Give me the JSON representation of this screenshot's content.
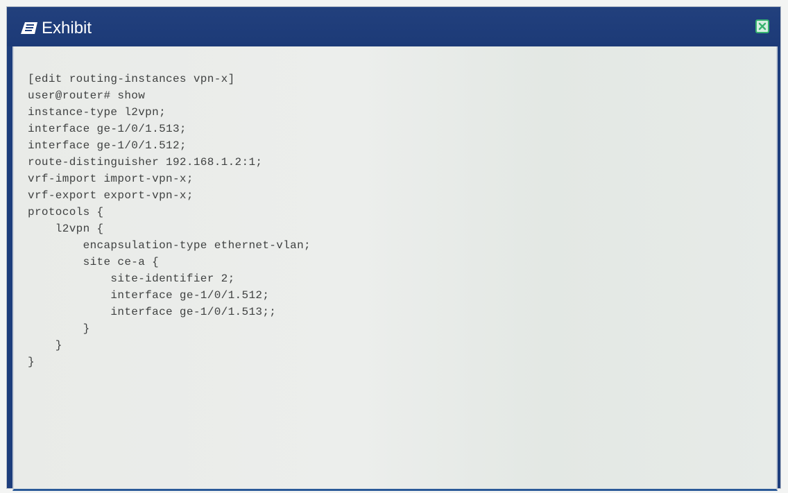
{
  "window": {
    "title": "Exhibit",
    "icons": {
      "title": "exhibit-icon",
      "close": "close-x-icon"
    },
    "colors": {
      "titlebar": "#1d3d7c",
      "close": "#36b36f",
      "content_background": "#eceeec",
      "text": "#3f4141"
    }
  },
  "code": {
    "lines": [
      "[edit routing-instances vpn-x]",
      "user@router# show",
      "instance-type l2vpn;",
      "interface ge-1/0/1.513;",
      "interface ge-1/0/1.512;",
      "route-distinguisher 192.168.1.2:1;",
      "vrf-import import-vpn-x;",
      "vrf-export export-vpn-x;",
      "protocols {",
      "    l2vpn {",
      "        encapsulation-type ethernet-vlan;",
      "        site ce-a {",
      "            site-identifier 2;",
      "            interface ge-1/0/1.512;",
      "            interface ge-1/0/1.513;;",
      "        }",
      "    }",
      "}"
    ]
  }
}
